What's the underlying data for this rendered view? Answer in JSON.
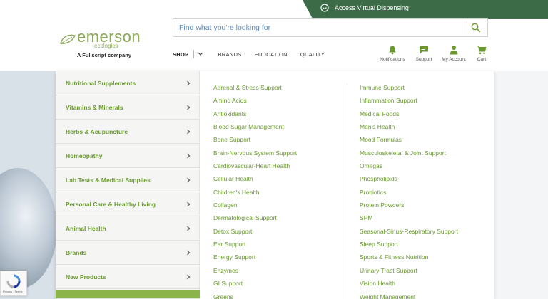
{
  "banner": {
    "link_text": "Access Virtual Dispensing"
  },
  "logo": {
    "brand": "emerson",
    "sub": "ecologics",
    "tagline": "A Fullscript company"
  },
  "search": {
    "placeholder": "Find what you're looking for",
    "icon": "search-icon"
  },
  "nav": {
    "shop": "SHOP",
    "brands": "BRANDS",
    "education": "EDUCATION",
    "quality": "QUALITY"
  },
  "header_icons": {
    "notifications": "Notifications",
    "support": "Support",
    "account": "My Account",
    "cart": "Cart"
  },
  "categories": [
    "Nutritional Supplements",
    "Vitamins & Minerals",
    "Herbs & Acupuncture",
    "Homeopathy",
    "Lab Tests & Medical Supplies",
    "Personal Care & Healthy Living",
    "Animal Health",
    "Brands",
    "New Products"
  ],
  "subcategories_col1": [
    "Adrenal & Stress Support",
    "Amino Acids",
    "Antioxidants",
    "Blood Sugar Management",
    "Bone Support",
    "Brain-Nervous System Support",
    "Cardiovascular-Heart Health",
    "Cellular Health",
    "Children's Health",
    "Collagen",
    "Dermatological Support",
    "Detox Support",
    "Ear Support",
    "Energy Support",
    "Enzymes",
    "GI Support",
    "Greens"
  ],
  "subcategories_col2": [
    "Immune Support",
    "Inflammation Support",
    "Medical Foods",
    "Men's Health",
    "Mood Formulas",
    "Musculoskeletal & Joint Support",
    "Omegas",
    "Phospholipids",
    "Probiotics",
    "Protein Powders",
    "SPM",
    "Seasonal-Sinus-Respiratory Support",
    "Sleep Support",
    "Sports & Fitness Nutrition",
    "Urinary Tract Support",
    "Vision Health",
    "Weight Management"
  ],
  "recaptcha": {
    "text": "Privacy - Terms"
  },
  "colors": {
    "brand_green": "#8aa856",
    "link_green": "#6a9a2e",
    "banner": "#3c6b47"
  }
}
